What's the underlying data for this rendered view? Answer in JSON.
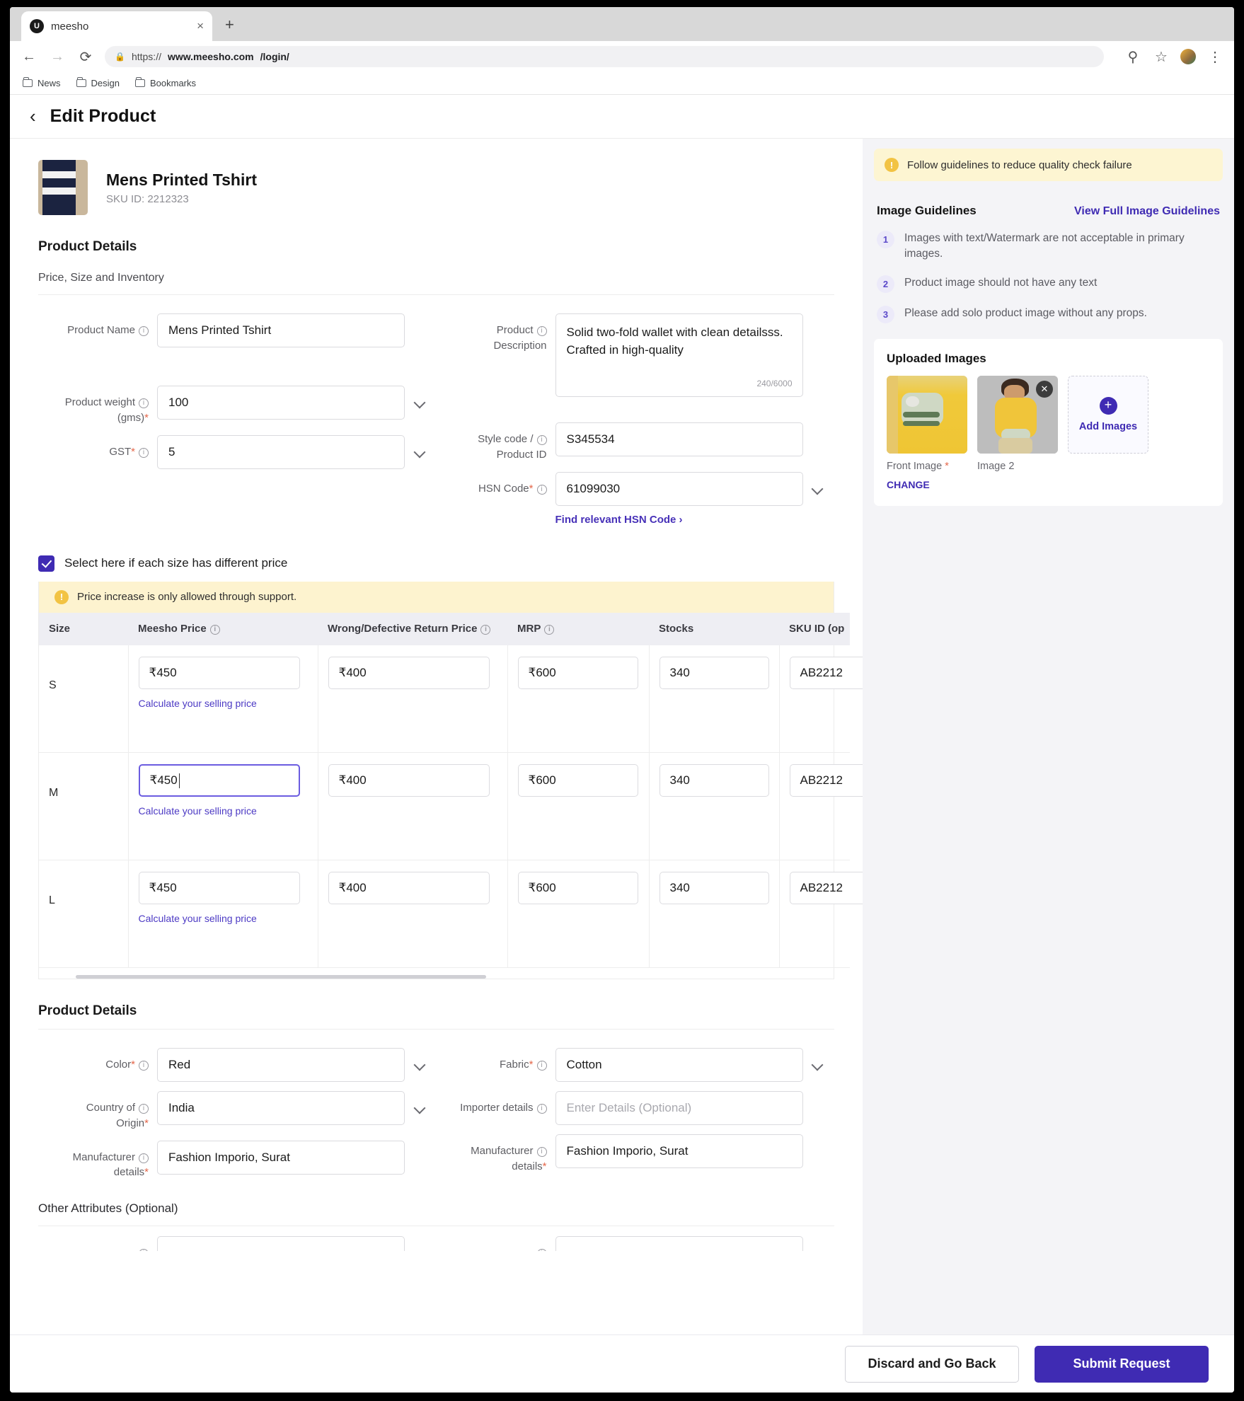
{
  "browser": {
    "tab_title": "meesho",
    "tab_favicon_letter": "U",
    "url_prefix": "https://",
    "url_domain": "www.meesho.com",
    "url_path": "/login/",
    "bookmarks": [
      "News",
      "Design",
      "Bookmarks"
    ]
  },
  "header": {
    "title": "Edit Product",
    "back_icon": "‹"
  },
  "product": {
    "name": "Mens Printed Tshirt",
    "sku_label": "SKU ID: 2212323"
  },
  "sections": {
    "product_details": "Product Details",
    "price_size_inventory": "Price, Size and Inventory",
    "product_details_2": "Product Details",
    "other_attributes": "Other Attributes (Optional)"
  },
  "form": {
    "product_name": {
      "label": "Product Name",
      "value": "Mens Printed Tshirt"
    },
    "product_description": {
      "label_line1": "Product",
      "label_line2": "Description",
      "value": "Solid two-fold wallet with clean detailsss. Crafted in high-quality",
      "counter": "240/6000"
    },
    "product_weight": {
      "label_line1": "Product weight",
      "label_line2": "(gms)",
      "value": "100"
    },
    "gst": {
      "label": "GST",
      "value": "5"
    },
    "style_code": {
      "label_line1": "Style code /",
      "label_line2": "Product ID",
      "value": "S345534"
    },
    "hsn_code": {
      "label": "HSN Code",
      "value": "61099030",
      "link": "Find relevant HSN Code",
      "link_chevron": "›"
    },
    "color": {
      "label": "Color",
      "value": "Red"
    },
    "fabric": {
      "label": "Fabric",
      "value": "Cotton"
    },
    "country_of_origin": {
      "label_line1": "Country of",
      "label_line2": "Origin",
      "value": "India"
    },
    "importer_details": {
      "label": "Importer details",
      "placeholder": "Enter Details (Optional)",
      "value": ""
    },
    "manufacturer_details_left": {
      "label_line1": "Manufacturer",
      "label_line2": "details",
      "value": "Fashion Imporio, Surat"
    },
    "manufacturer_details_right": {
      "label_line1": "Manufacturer",
      "label_line2": "details",
      "value": "Fashion Imporio, Surat"
    }
  },
  "different_price_checkbox": {
    "label": "Select here if each size has different price",
    "checked": true
  },
  "price_banner": {
    "text": "Price increase is only allowed through support.",
    "icon": "!"
  },
  "price_table": {
    "columns": [
      "Size",
      "Meesho Price",
      "Wrong/Defective Return Price",
      "MRP",
      "Stocks",
      "SKU ID (op"
    ],
    "calc_link": "Calculate your selling price",
    "rows": [
      {
        "size": "S",
        "meesho_price": "₹450",
        "return_price": "₹400",
        "mrp": "₹600",
        "stocks": "340",
        "sku_id": "AB2212",
        "focused": false
      },
      {
        "size": "M",
        "meesho_price": "₹450",
        "return_price": "₹400",
        "mrp": "₹600",
        "stocks": "340",
        "sku_id": "AB2212",
        "focused": true
      },
      {
        "size": "L",
        "meesho_price": "₹450",
        "return_price": "₹400",
        "mrp": "₹600",
        "stocks": "340",
        "sku_id": "AB2212",
        "focused": false
      }
    ]
  },
  "right_panel": {
    "banner": {
      "text": "Follow guidelines to reduce quality check failure",
      "icon": "!"
    },
    "image_guidelines_title": "Image Guidelines",
    "view_full_link": "View Full Image Guidelines",
    "guidelines": [
      {
        "num": "1",
        "text": "Images with text/Watermark are not acceptable in primary images."
      },
      {
        "num": "2",
        "text": "Product image should not have any text"
      },
      {
        "num": "3",
        "text": "Please add solo product image without any props."
      }
    ],
    "uploaded_images_title": "Uploaded Images",
    "images": [
      {
        "caption": "Front Image",
        "required": true,
        "action": "CHANGE",
        "removable": false
      },
      {
        "caption": "Image 2",
        "required": false,
        "action": "",
        "removable": true
      }
    ],
    "add_images_label": "Add Images",
    "add_icon": "+",
    "remove_icon": "✕"
  },
  "footer": {
    "discard_label": "Discard and Go Back",
    "submit_label": "Submit Request"
  },
  "colors": {
    "brand_purple": "#3f2bb3",
    "link_purple": "#4731b8",
    "warning_yellow": "#fdf3cf",
    "accent_red": "#e4674a"
  }
}
